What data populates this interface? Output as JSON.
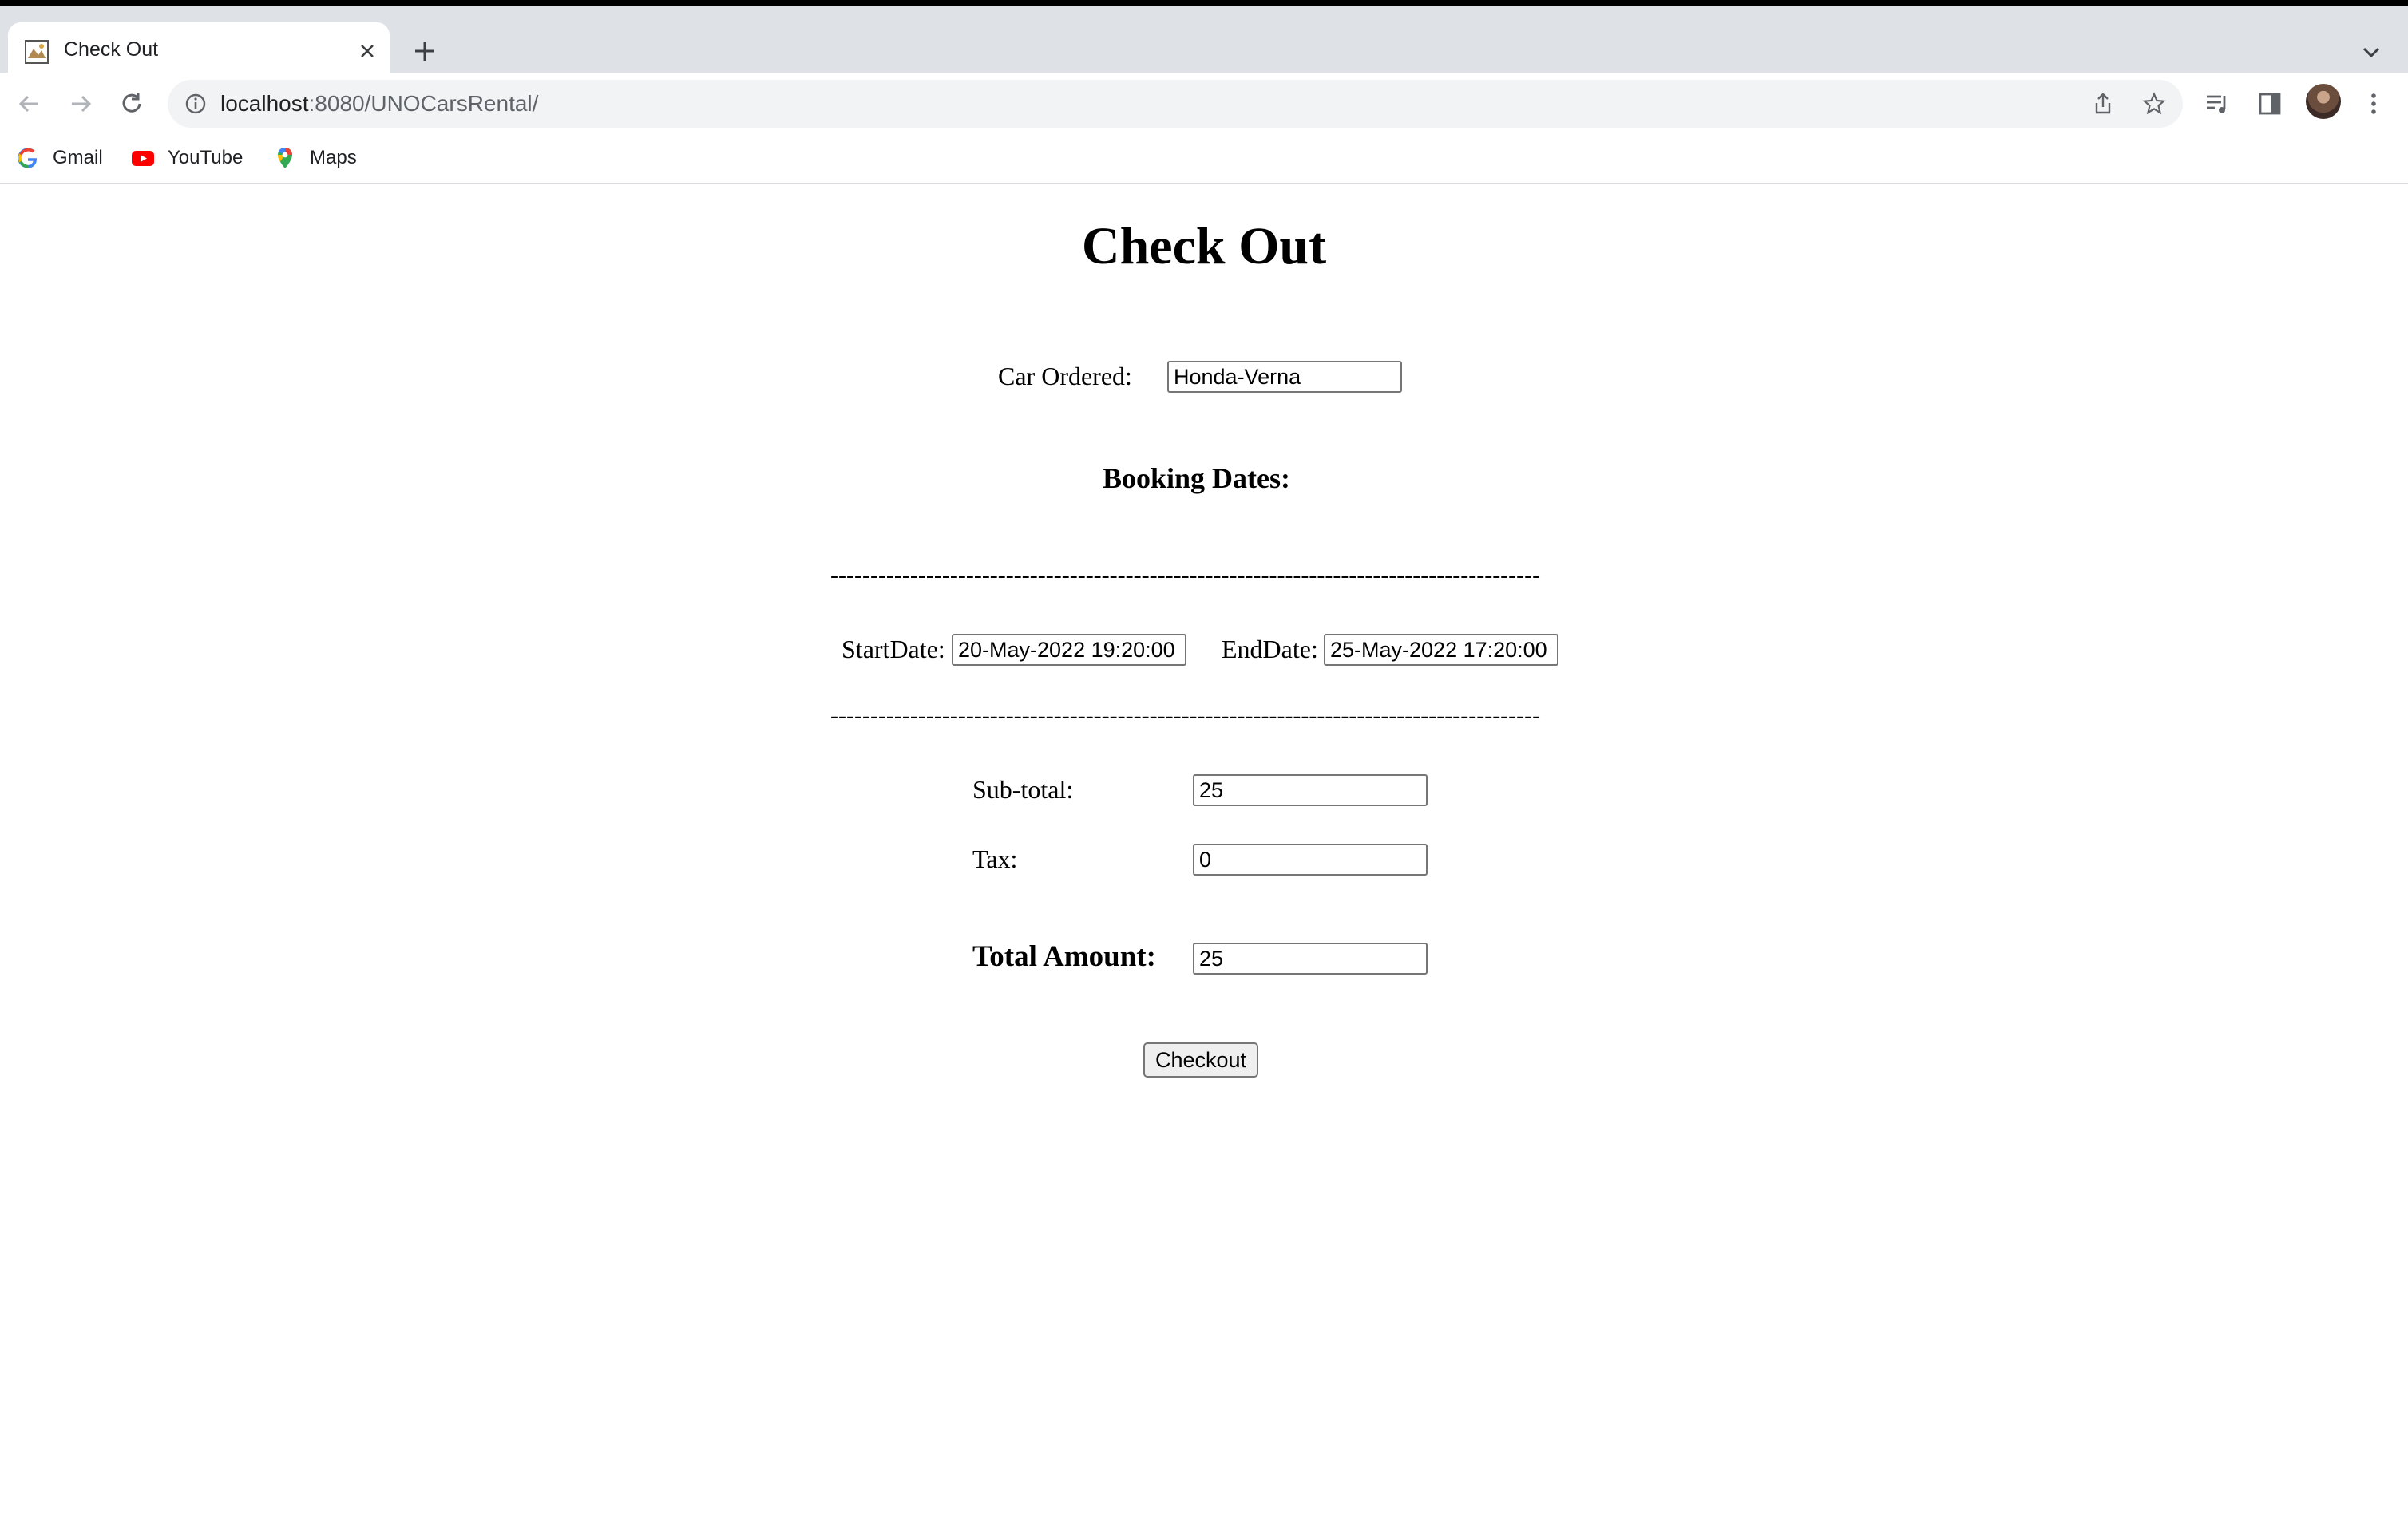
{
  "browser": {
    "tab_title": "Check Out",
    "url_host": "localhost",
    "url_rest": ":8080/UNOCarsRental/",
    "bookmarks": [
      "Gmail",
      "YouTube",
      "Maps"
    ]
  },
  "page": {
    "title": "Check Out",
    "car_label": "Car Ordered:",
    "car_value": "Honda-Verna",
    "booking_heading": "Booking Dates:",
    "separator": "-----------------------------------------------------------------------------------------",
    "start_label": "StartDate:",
    "start_value": "20-May-2022 19:20:00",
    "end_label": "EndDate:",
    "end_value": "25-May-2022 17:20:00",
    "subtotal_label": "Sub-total:",
    "subtotal_value": "25",
    "tax_label": "Tax:",
    "tax_value": "0",
    "total_label": "Total Amount:",
    "total_value": "25",
    "checkout_label": "Checkout"
  },
  "colors": {
    "tabstrip": "#dee1e6",
    "omnibox": "#f1f3f4",
    "icon": "#5f6368"
  },
  "icons": [
    "page-favicon-icon",
    "close-icon",
    "plus-icon",
    "chevron-down-icon",
    "back-arrow-icon",
    "forward-arrow-icon",
    "reload-icon",
    "info-icon",
    "share-icon",
    "star-icon",
    "media-icon",
    "side-panel-icon",
    "kebab-menu-icon",
    "google-icon",
    "youtube-icon",
    "maps-pin-icon"
  ]
}
